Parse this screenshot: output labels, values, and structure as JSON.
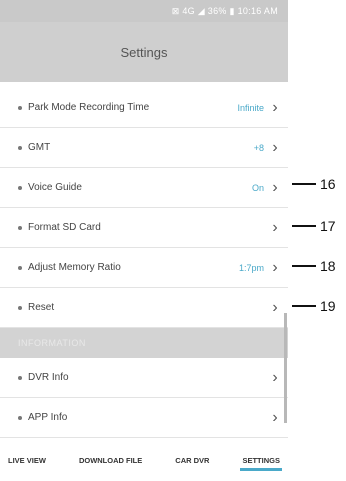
{
  "status_bar": {
    "text": "⊠ 4G ◢ 36% ▮ 10:16 AM"
  },
  "header": {
    "title": "Settings"
  },
  "settings": [
    {
      "label": "Park Mode Recording Time",
      "value": "Infinite",
      "chevron": "›"
    },
    {
      "label": "GMT",
      "value": "+8",
      "chevron": "›"
    },
    {
      "label": "Voice Guide",
      "value": "On",
      "chevron": "›"
    },
    {
      "label": "Format SD Card",
      "value": "",
      "chevron": "›"
    },
    {
      "label": "Adjust Memory Ratio",
      "value": "1:7pm",
      "chevron": "›"
    },
    {
      "label": "Reset",
      "value": "",
      "chevron": "›"
    }
  ],
  "information": {
    "header": "INFORMATION",
    "items": [
      {
        "label": "DVR Info",
        "chevron": "›"
      },
      {
        "label": "APP Info",
        "chevron": "›"
      }
    ]
  },
  "bottom_nav": {
    "tabs": [
      "LIVE VIEW",
      "DOWNLOAD FILE",
      "CAR DVR",
      "SETTINGS"
    ],
    "active": "SETTINGS"
  },
  "callouts": [
    "16",
    "17",
    "18",
    "19"
  ],
  "colors": {
    "accent": "#4aa9c9",
    "header_bg": "#cfcfcf"
  }
}
